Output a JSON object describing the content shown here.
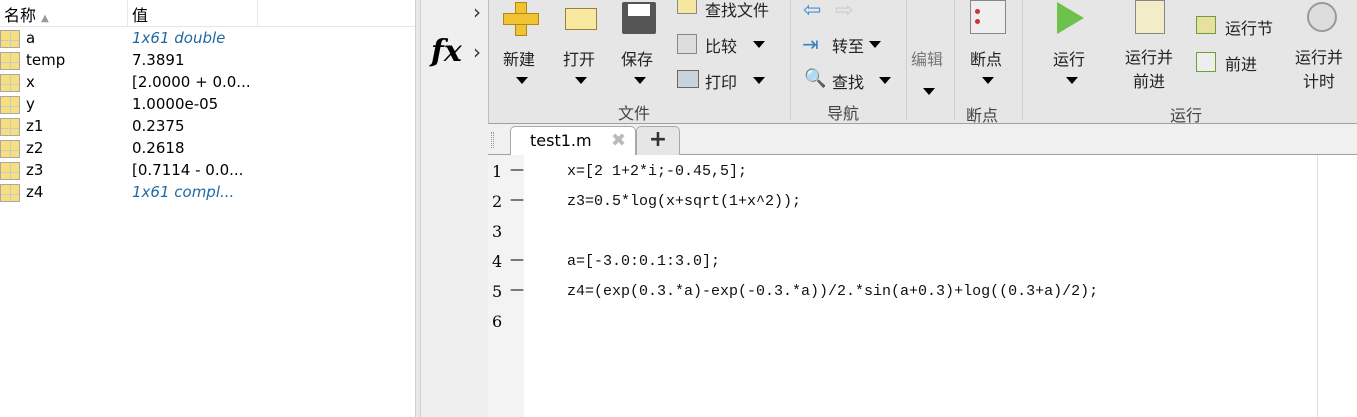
{
  "workspace": {
    "col_name": "名称",
    "col_value": "值",
    "sort_icon": "sort-ascending-icon",
    "vars": [
      {
        "name": "a",
        "value": "1x61 double",
        "italic": true
      },
      {
        "name": "temp",
        "value": "7.3891",
        "italic": false
      },
      {
        "name": "x",
        "value": "[2.0000 + 0.0...",
        "italic": false
      },
      {
        "name": "y",
        "value": "1.0000e-05",
        "italic": false
      },
      {
        "name": "z1",
        "value": "0.2375",
        "italic": false
      },
      {
        "name": "z2",
        "value": "0.2618",
        "italic": false
      },
      {
        "name": "z3",
        "value": "[0.7114 - 0.0...",
        "italic": false
      },
      {
        "name": "z4",
        "value": "1x61 compl...",
        "italic": true
      }
    ]
  },
  "fx_label": "fx",
  "toolbar": {
    "new": "新建",
    "open": "打开",
    "save": "保存",
    "find_files": "查找文件",
    "compare": "比较",
    "print": "打印",
    "file_group": "文件",
    "goto": "转至",
    "find": "查找",
    "nav_group": "导航",
    "edit": "编辑",
    "breakpoints": "断点",
    "bp_group": "断点",
    "run": "运行",
    "run_advance": [
      "运行并",
      "前进"
    ],
    "run_section": "运行节",
    "advance": "前进",
    "run_time": [
      "运行并",
      "计时"
    ],
    "run_group": "运行"
  },
  "tabs": [
    {
      "label": "test1.m",
      "active": true
    }
  ],
  "add_tab": "+",
  "editor": {
    "lines": [
      {
        "n": "1",
        "dash": "—",
        "code": "x=[2 1+2*i;-0.45,5];"
      },
      {
        "n": "2",
        "dash": "—",
        "code": "z3=0.5*log(x+sqrt(1+x^2));"
      },
      {
        "n": "3",
        "dash": "",
        "code": ""
      },
      {
        "n": "4",
        "dash": "—",
        "code": "a=[-3.0:0.1:3.0];"
      },
      {
        "n": "5",
        "dash": "—",
        "code": "z4=(exp(0.3.*a)-exp(-0.3.*a))/2.*sin(a+0.3)+log((0.3+a)/2);"
      },
      {
        "n": "6",
        "dash": "",
        "code": ""
      }
    ]
  }
}
